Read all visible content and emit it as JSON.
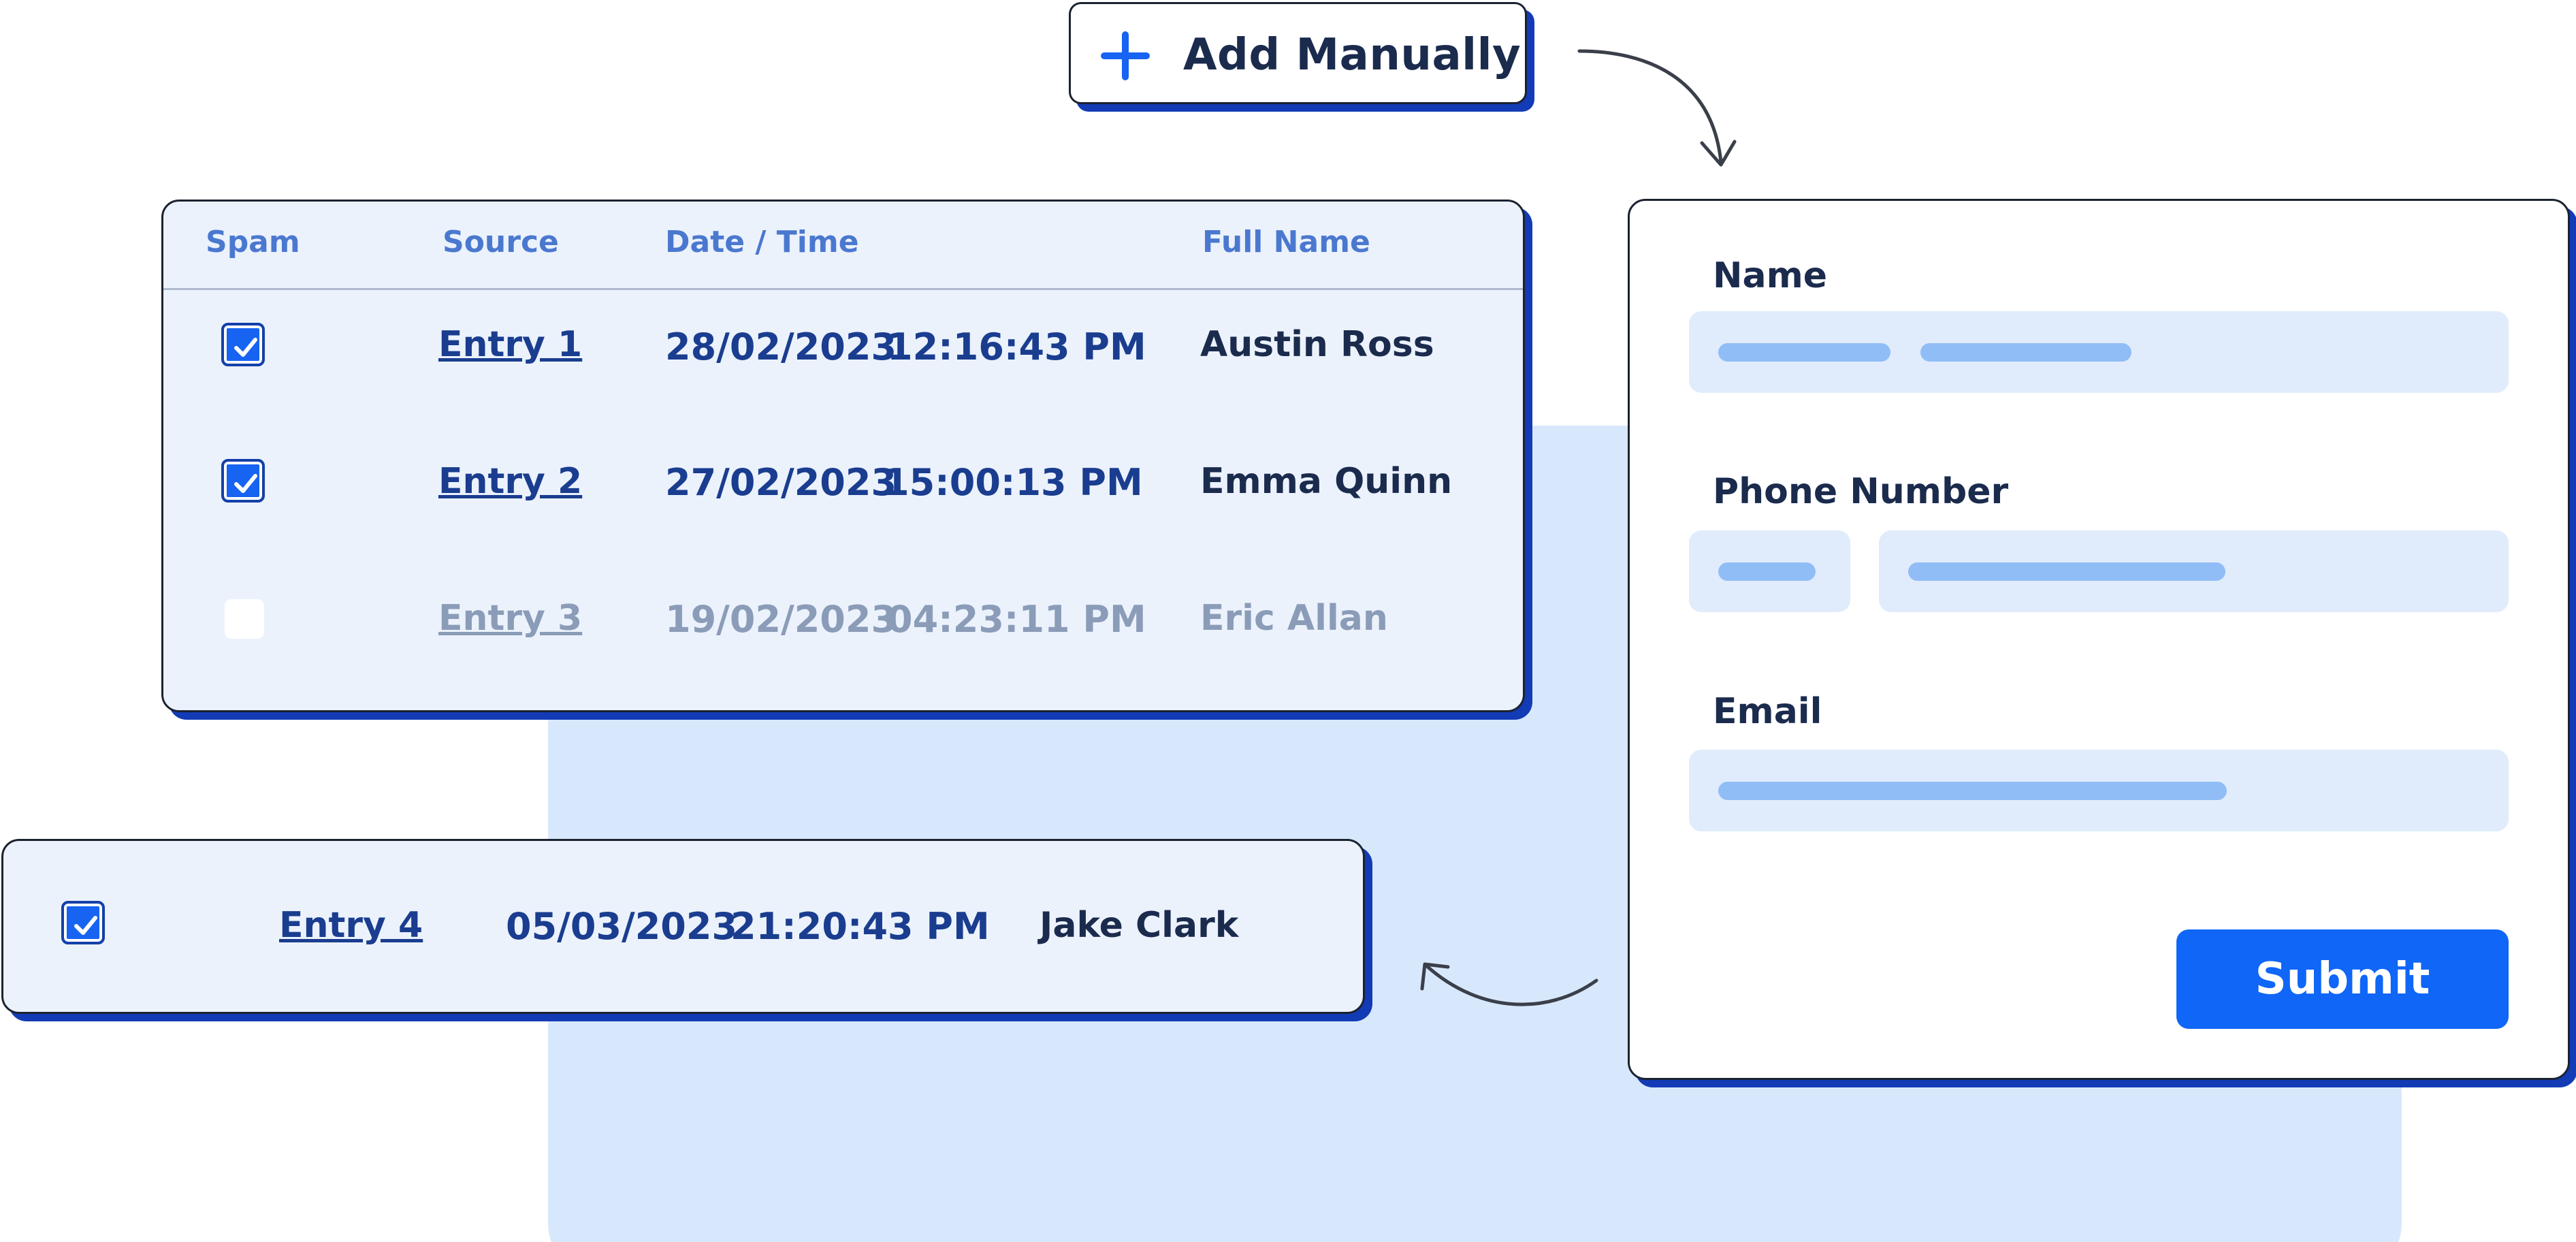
{
  "add_button": {
    "label": "Add Manually",
    "icon": "plus-icon"
  },
  "table": {
    "headers": {
      "spam": "Spam",
      "source": "Source",
      "datetime": "Date / Time",
      "fullname": "Full Name"
    },
    "rows": [
      {
        "spam": true,
        "source": "Entry 1",
        "date": "28/02/2023",
        "time": "12:16:43 PM",
        "name": "Austin Ross",
        "muted": false
      },
      {
        "spam": true,
        "source": "Entry 2",
        "date": "27/02/2023",
        "time": "15:00:13 PM",
        "name": "Emma Quinn",
        "muted": false
      },
      {
        "spam": false,
        "source": "Entry 3",
        "date": "19/02/2023",
        "time": "04:23:11 PM",
        "name": "Eric Allan",
        "muted": true
      }
    ]
  },
  "added_entry": {
    "spam": true,
    "source": "Entry 4",
    "date": "05/03/2023",
    "time": "21:20:43 PM",
    "name": "Jake Clark"
  },
  "form": {
    "name_label": "Name",
    "phone_label": "Phone Number",
    "email_label": "Email",
    "submit_label": "Submit"
  },
  "colors": {
    "accent": "#0f66f7",
    "shadow": "#123bb5",
    "background_panel": "#d8e8fc",
    "input_fill": "#e0ecfc",
    "placeholder_bar": "#91bdf7"
  },
  "icons": [
    "plus-icon",
    "checkmark-icon",
    "arrow-down-icon",
    "arrow-left-icon"
  ]
}
